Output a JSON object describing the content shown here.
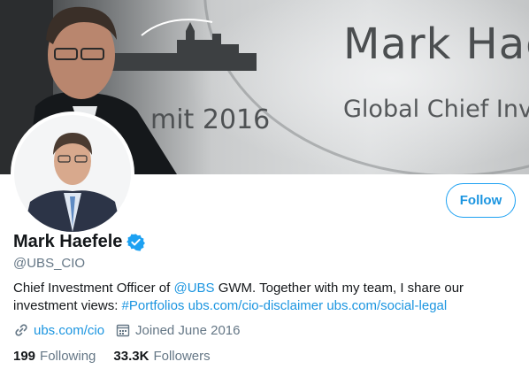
{
  "banner": {
    "bg_name": "Mark Haefele",
    "bg_title": "Global Chief Investment Officer",
    "bg_summit": "mit 2016"
  },
  "profile": {
    "display_name": "Mark Haefele",
    "handle": "@UBS_CIO",
    "verified_icon": "verified-badge-icon",
    "verified_color": "#1da1f2"
  },
  "follow_button": {
    "label": "Follow"
  },
  "bio": {
    "part1": "Chief Investment Officer of ",
    "mention": "@UBS",
    "part2": " GWM. Together with my team, I share our investment views: ",
    "hashtag": "#Portfolios",
    "link1": "ubs.com/cio-disclaimer",
    "link2": "ubs.com/social-legal"
  },
  "meta": {
    "website": "ubs.com/cio",
    "joined": "Joined June 2016",
    "link_icon": "link-icon",
    "calendar_icon": "calendar-icon"
  },
  "stats": {
    "following_count": "199",
    "following_label": "Following",
    "followers_count": "33.3K",
    "followers_label": "Followers"
  },
  "colors": {
    "accent": "#1da1f2",
    "link": "#1b95e0",
    "secondary_text": "#657786"
  }
}
